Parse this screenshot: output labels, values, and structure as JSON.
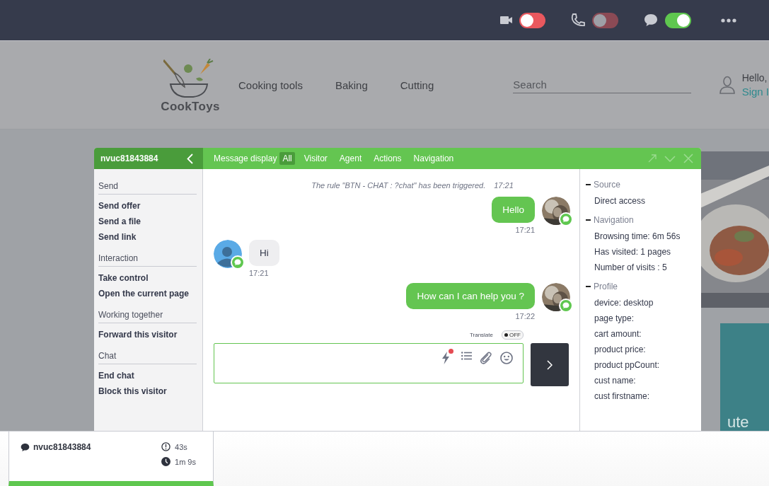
{
  "top_bar": {
    "toggles": [
      {
        "kind": "video",
        "on": false,
        "disabled": false
      },
      {
        "kind": "phone",
        "on": false,
        "disabled": true
      },
      {
        "kind": "chat",
        "on": true,
        "disabled": false
      }
    ]
  },
  "site": {
    "logo_text": "CookToys",
    "nav": [
      "Cooking tools",
      "Baking",
      "Cutting"
    ],
    "search": {
      "placeholder": "Search"
    },
    "greeting": "Hello,",
    "sign_in": "Sign I",
    "promo_text": "ute"
  },
  "chat_panel": {
    "visitor_id": "nvuc81843884",
    "sidebar": [
      {
        "title": "Send",
        "items": [
          "Send offer",
          "Send a file",
          "Send link"
        ]
      },
      {
        "title": "Interaction",
        "items": [
          "Take control",
          "Open the current page"
        ]
      },
      {
        "title": "Working together",
        "items": [
          "Forward this visitor"
        ]
      },
      {
        "title": "Chat",
        "items": [
          "End chat",
          "Block this visitor"
        ]
      }
    ],
    "filter_label": "Message display",
    "tabs": [
      {
        "label": "All",
        "selected": true
      },
      {
        "label": "Visitor",
        "selected": false
      },
      {
        "label": "Agent",
        "selected": false
      },
      {
        "label": "Actions",
        "selected": false
      },
      {
        "label": "Navigation",
        "selected": false
      }
    ],
    "messages": [
      {
        "kind": "system",
        "text": "The rule \"BTN - CHAT : ?chat\" has been triggered.",
        "time": "17:21"
      },
      {
        "kind": "agent",
        "text": "Hello",
        "time": "17:21"
      },
      {
        "kind": "visitor",
        "text": "Hi",
        "time": "17:21"
      },
      {
        "kind": "agent",
        "text": "How can I can help you ?",
        "time": "17:22"
      }
    ],
    "translate": {
      "label": "Translate",
      "on": false,
      "state_text": "OFF"
    },
    "composer": {
      "notification": true
    },
    "info": [
      {
        "title": "Source",
        "expanded": true,
        "items": [
          "Direct access"
        ]
      },
      {
        "title": "Navigation",
        "expanded": true,
        "items": [
          "Browsing time: 6m 56s",
          "Has visited: 1 pages",
          "Number of visits : 5"
        ]
      },
      {
        "title": "Profile",
        "expanded": true,
        "items": [
          "device: desktop",
          "page type:",
          "cart amount:",
          "product price:",
          "product ppCount:",
          "cust name:",
          "cust firstname:"
        ]
      }
    ]
  },
  "dock": {
    "conversations": [
      {
        "name": "nvuc81843884",
        "waiting": "43s",
        "duration": "1m 9s",
        "selected": true
      }
    ]
  }
}
